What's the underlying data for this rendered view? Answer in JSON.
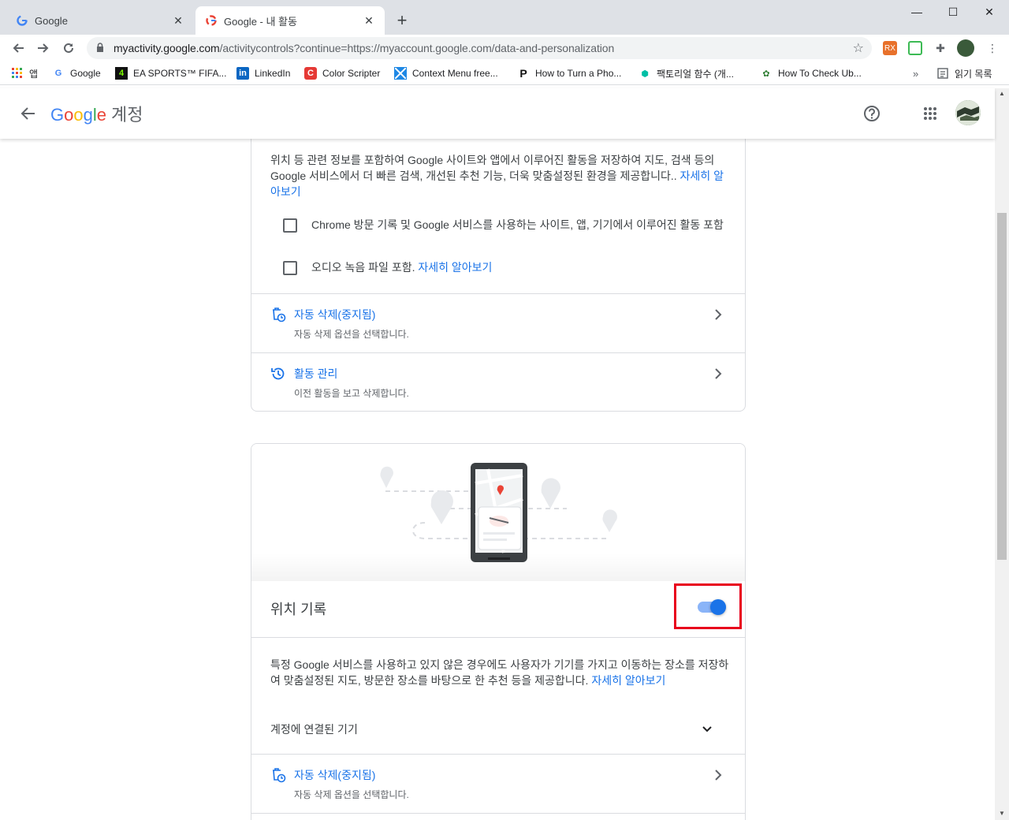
{
  "browser": {
    "tabs": [
      {
        "title": "Google",
        "active": false
      },
      {
        "title": "Google - 내 활동",
        "active": true
      }
    ],
    "url_host": "myactivity.google.com",
    "url_path": "/activitycontrols?continue=https://myaccount.google.com/data-and-personalization",
    "bookmarks": [
      {
        "label": "앱",
        "icon": "apps-grid-icon"
      },
      {
        "label": "Google",
        "icon": "google-g-icon"
      },
      {
        "label": "EA SPORTS™ FIFA...",
        "icon": "ea-sports-icon"
      },
      {
        "label": "LinkedIn",
        "icon": "linkedin-icon"
      },
      {
        "label": "Color Scripter",
        "icon": "color-scripter-icon"
      },
      {
        "label": "Context Menu free...",
        "icon": "context-menu-icon"
      },
      {
        "label": "How to Turn a Pho...",
        "icon": "p-icon"
      },
      {
        "label": "팩토리얼 함수 (개...",
        "icon": "factorial-icon"
      },
      {
        "label": "How To Check Ub...",
        "icon": "ubuntu-icon"
      }
    ],
    "overflow": "»",
    "reading_list": "읽기 목록"
  },
  "header": {
    "brand": "Google",
    "account_label": "계정"
  },
  "web_activity_card": {
    "description": "위치 등 관련 정보를 포함하여 Google 사이트와 앱에서 이루어진 활동을 저장하여 지도, 검색 등의 Google 서비스에서 더 빠른 검색, 개선된 추천 기능, 더욱 맞춤설정된 환경을 제공합니다..",
    "learn_more": "자세히 알아보기",
    "checkbox_1": "Chrome 방문 기록 및 Google 서비스를 사용하는 사이트, 앱, 기기에서 이루어진 활동 포함",
    "checkbox_2": "오디오 녹음 파일 포함.",
    "checkbox_2_link": "자세히 알아보기",
    "auto_delete_title": "자동 삭제(중지됨)",
    "auto_delete_sub": "자동 삭제 옵션을 선택합니다.",
    "manage_title": "활동 관리",
    "manage_sub": "이전 활동을 보고 삭제합니다."
  },
  "location_card": {
    "title": "위치 기록",
    "toggle_on": true,
    "description": "특정 Google 서비스를 사용하고 있지 않은 경우에도 사용자가 기기를 가지고 이동하는 장소를 저장하여 맞춤설정된 지도, 방문한 장소를 바탕으로 한 추천 등을 제공합니다.",
    "learn_more": "자세히 알아보기",
    "devices_label": "계정에 연결된 기기",
    "auto_delete_title": "자동 삭제(중지됨)",
    "auto_delete_sub": "자동 삭제 옵션을 선택합니다."
  },
  "colors": {
    "accent": "#1a73e8",
    "highlight": "#e8001c"
  }
}
